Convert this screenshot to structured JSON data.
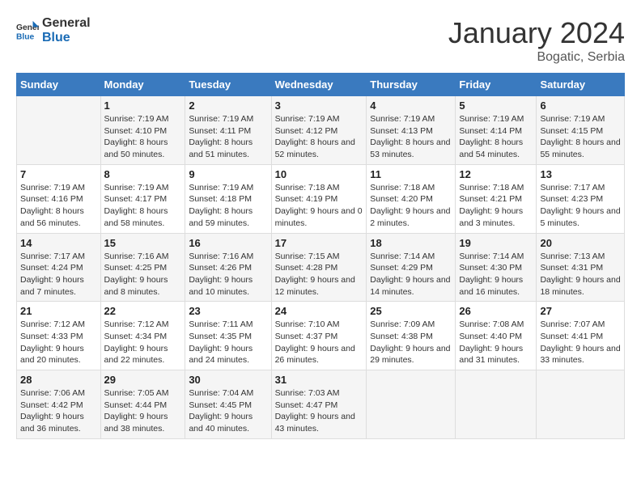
{
  "header": {
    "logo_general": "General",
    "logo_blue": "Blue",
    "title": "January 2024",
    "subtitle": "Bogatic, Serbia"
  },
  "weekdays": [
    "Sunday",
    "Monday",
    "Tuesday",
    "Wednesday",
    "Thursday",
    "Friday",
    "Saturday"
  ],
  "weeks": [
    [
      {
        "day": "",
        "sunrise": "",
        "sunset": "",
        "daylight": ""
      },
      {
        "day": "1",
        "sunrise": "Sunrise: 7:19 AM",
        "sunset": "Sunset: 4:10 PM",
        "daylight": "Daylight: 8 hours and 50 minutes."
      },
      {
        "day": "2",
        "sunrise": "Sunrise: 7:19 AM",
        "sunset": "Sunset: 4:11 PM",
        "daylight": "Daylight: 8 hours and 51 minutes."
      },
      {
        "day": "3",
        "sunrise": "Sunrise: 7:19 AM",
        "sunset": "Sunset: 4:12 PM",
        "daylight": "Daylight: 8 hours and 52 minutes."
      },
      {
        "day": "4",
        "sunrise": "Sunrise: 7:19 AM",
        "sunset": "Sunset: 4:13 PM",
        "daylight": "Daylight: 8 hours and 53 minutes."
      },
      {
        "day": "5",
        "sunrise": "Sunrise: 7:19 AM",
        "sunset": "Sunset: 4:14 PM",
        "daylight": "Daylight: 8 hours and 54 minutes."
      },
      {
        "day": "6",
        "sunrise": "Sunrise: 7:19 AM",
        "sunset": "Sunset: 4:15 PM",
        "daylight": "Daylight: 8 hours and 55 minutes."
      }
    ],
    [
      {
        "day": "7",
        "sunrise": "Sunrise: 7:19 AM",
        "sunset": "Sunset: 4:16 PM",
        "daylight": "Daylight: 8 hours and 56 minutes."
      },
      {
        "day": "8",
        "sunrise": "Sunrise: 7:19 AM",
        "sunset": "Sunset: 4:17 PM",
        "daylight": "Daylight: 8 hours and 58 minutes."
      },
      {
        "day": "9",
        "sunrise": "Sunrise: 7:19 AM",
        "sunset": "Sunset: 4:18 PM",
        "daylight": "Daylight: 8 hours and 59 minutes."
      },
      {
        "day": "10",
        "sunrise": "Sunrise: 7:18 AM",
        "sunset": "Sunset: 4:19 PM",
        "daylight": "Daylight: 9 hours and 0 minutes."
      },
      {
        "day": "11",
        "sunrise": "Sunrise: 7:18 AM",
        "sunset": "Sunset: 4:20 PM",
        "daylight": "Daylight: 9 hours and 2 minutes."
      },
      {
        "day": "12",
        "sunrise": "Sunrise: 7:18 AM",
        "sunset": "Sunset: 4:21 PM",
        "daylight": "Daylight: 9 hours and 3 minutes."
      },
      {
        "day": "13",
        "sunrise": "Sunrise: 7:17 AM",
        "sunset": "Sunset: 4:23 PM",
        "daylight": "Daylight: 9 hours and 5 minutes."
      }
    ],
    [
      {
        "day": "14",
        "sunrise": "Sunrise: 7:17 AM",
        "sunset": "Sunset: 4:24 PM",
        "daylight": "Daylight: 9 hours and 7 minutes."
      },
      {
        "day": "15",
        "sunrise": "Sunrise: 7:16 AM",
        "sunset": "Sunset: 4:25 PM",
        "daylight": "Daylight: 9 hours and 8 minutes."
      },
      {
        "day": "16",
        "sunrise": "Sunrise: 7:16 AM",
        "sunset": "Sunset: 4:26 PM",
        "daylight": "Daylight: 9 hours and 10 minutes."
      },
      {
        "day": "17",
        "sunrise": "Sunrise: 7:15 AM",
        "sunset": "Sunset: 4:28 PM",
        "daylight": "Daylight: 9 hours and 12 minutes."
      },
      {
        "day": "18",
        "sunrise": "Sunrise: 7:14 AM",
        "sunset": "Sunset: 4:29 PM",
        "daylight": "Daylight: 9 hours and 14 minutes."
      },
      {
        "day": "19",
        "sunrise": "Sunrise: 7:14 AM",
        "sunset": "Sunset: 4:30 PM",
        "daylight": "Daylight: 9 hours and 16 minutes."
      },
      {
        "day": "20",
        "sunrise": "Sunrise: 7:13 AM",
        "sunset": "Sunset: 4:31 PM",
        "daylight": "Daylight: 9 hours and 18 minutes."
      }
    ],
    [
      {
        "day": "21",
        "sunrise": "Sunrise: 7:12 AM",
        "sunset": "Sunset: 4:33 PM",
        "daylight": "Daylight: 9 hours and 20 minutes."
      },
      {
        "day": "22",
        "sunrise": "Sunrise: 7:12 AM",
        "sunset": "Sunset: 4:34 PM",
        "daylight": "Daylight: 9 hours and 22 minutes."
      },
      {
        "day": "23",
        "sunrise": "Sunrise: 7:11 AM",
        "sunset": "Sunset: 4:35 PM",
        "daylight": "Daylight: 9 hours and 24 minutes."
      },
      {
        "day": "24",
        "sunrise": "Sunrise: 7:10 AM",
        "sunset": "Sunset: 4:37 PM",
        "daylight": "Daylight: 9 hours and 26 minutes."
      },
      {
        "day": "25",
        "sunrise": "Sunrise: 7:09 AM",
        "sunset": "Sunset: 4:38 PM",
        "daylight": "Daylight: 9 hours and 29 minutes."
      },
      {
        "day": "26",
        "sunrise": "Sunrise: 7:08 AM",
        "sunset": "Sunset: 4:40 PM",
        "daylight": "Daylight: 9 hours and 31 minutes."
      },
      {
        "day": "27",
        "sunrise": "Sunrise: 7:07 AM",
        "sunset": "Sunset: 4:41 PM",
        "daylight": "Daylight: 9 hours and 33 minutes."
      }
    ],
    [
      {
        "day": "28",
        "sunrise": "Sunrise: 7:06 AM",
        "sunset": "Sunset: 4:42 PM",
        "daylight": "Daylight: 9 hours and 36 minutes."
      },
      {
        "day": "29",
        "sunrise": "Sunrise: 7:05 AM",
        "sunset": "Sunset: 4:44 PM",
        "daylight": "Daylight: 9 hours and 38 minutes."
      },
      {
        "day": "30",
        "sunrise": "Sunrise: 7:04 AM",
        "sunset": "Sunset: 4:45 PM",
        "daylight": "Daylight: 9 hours and 40 minutes."
      },
      {
        "day": "31",
        "sunrise": "Sunrise: 7:03 AM",
        "sunset": "Sunset: 4:47 PM",
        "daylight": "Daylight: 9 hours and 43 minutes."
      },
      {
        "day": "",
        "sunrise": "",
        "sunset": "",
        "daylight": ""
      },
      {
        "day": "",
        "sunrise": "",
        "sunset": "",
        "daylight": ""
      },
      {
        "day": "",
        "sunrise": "",
        "sunset": "",
        "daylight": ""
      }
    ]
  ]
}
